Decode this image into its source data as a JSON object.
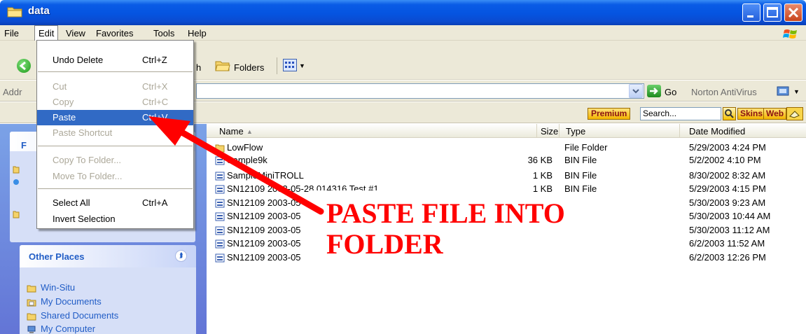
{
  "window": {
    "title": "data"
  },
  "menubar": [
    "File",
    "Edit",
    "View",
    "Favorites",
    "Tools",
    "Help"
  ],
  "toolbar": {
    "back_label": "Back",
    "search_partial": "h",
    "folders_label": "Folders"
  },
  "addressbar": {
    "label": "Addr",
    "go_label": "Go",
    "norton_label": "Norton AntiVirus"
  },
  "skinsbar": {
    "premium_label": "Premium",
    "search_placeholder": "Search...",
    "skins_label": "Skins",
    "web_label": "Web"
  },
  "edit_menu": [
    {
      "label": "Undo Delete",
      "shortcut": "Ctrl+Z",
      "disabled": false
    },
    {
      "label": "Cut",
      "shortcut": "Ctrl+X",
      "disabled": true
    },
    {
      "label": "Copy",
      "shortcut": "Ctrl+C",
      "disabled": true
    },
    {
      "label": "Paste",
      "shortcut": "Ctrl+V",
      "disabled": false,
      "highlighted": true
    },
    {
      "label": "Paste Shortcut",
      "shortcut": "",
      "disabled": true
    },
    {
      "label": "Copy To Folder...",
      "shortcut": "",
      "disabled": true
    },
    {
      "label": "Move To Folder...",
      "shortcut": "",
      "disabled": true
    },
    {
      "label": "Select All",
      "shortcut": "Ctrl+A",
      "disabled": false
    },
    {
      "label": "Invert Selection",
      "shortcut": "",
      "disabled": false
    }
  ],
  "left_pane": {
    "top_panel_title_partial": "F",
    "other_places_title": "Other Places",
    "places": [
      "Win-Situ",
      "My Documents",
      "Shared Documents",
      "My Computer"
    ]
  },
  "file_list": {
    "columns": {
      "name": "Name",
      "size": "Size",
      "type": "Type",
      "date": "Date Modified"
    },
    "rows": [
      {
        "name": "LowFlow",
        "size": "",
        "type": "File Folder",
        "date": "5/29/2003 4:24 PM",
        "icon": "folder-icon"
      },
      {
        "name": "Sample9k",
        "size": "36 KB",
        "type": "BIN File",
        "date": "5/2/2002 4:10 PM",
        "icon": "bin-file-icon"
      },
      {
        "name": "SampleMiniTROLL",
        "size": "1 KB",
        "type": "BIN File",
        "date": "8/30/2002 8:32 AM",
        "icon": "bin-file-icon"
      },
      {
        "name": "SN12109 2003-05-28 014316 Test #1",
        "size": "1 KB",
        "type": "BIN File",
        "date": "5/29/2003 4:15 PM",
        "icon": "bin-file-icon"
      },
      {
        "name": "SN12109 2003-05",
        "size": "",
        "type": "",
        "date": "5/30/2003 9:23 AM",
        "icon": "bin-file-icon"
      },
      {
        "name": "SN12109 2003-05",
        "size": "",
        "type": "",
        "date": "5/30/2003 10:44 AM",
        "icon": "bin-file-icon"
      },
      {
        "name": "SN12109 2003-05",
        "size": "",
        "type": "",
        "date": "5/30/2003 11:12 AM",
        "icon": "bin-file-icon"
      },
      {
        "name": "SN12109 2003-05",
        "size": "",
        "type": "",
        "date": "6/2/2003 11:52 AM",
        "icon": "bin-file-icon"
      },
      {
        "name": "SN12109 2003-05",
        "size": "",
        "type": "",
        "date": "6/2/2003 12:26 PM",
        "icon": "bin-file-icon"
      }
    ]
  },
  "annotation": {
    "line1": "PASTE FILE INTO",
    "line2": "FOLDER",
    "color": "#ff0000"
  }
}
